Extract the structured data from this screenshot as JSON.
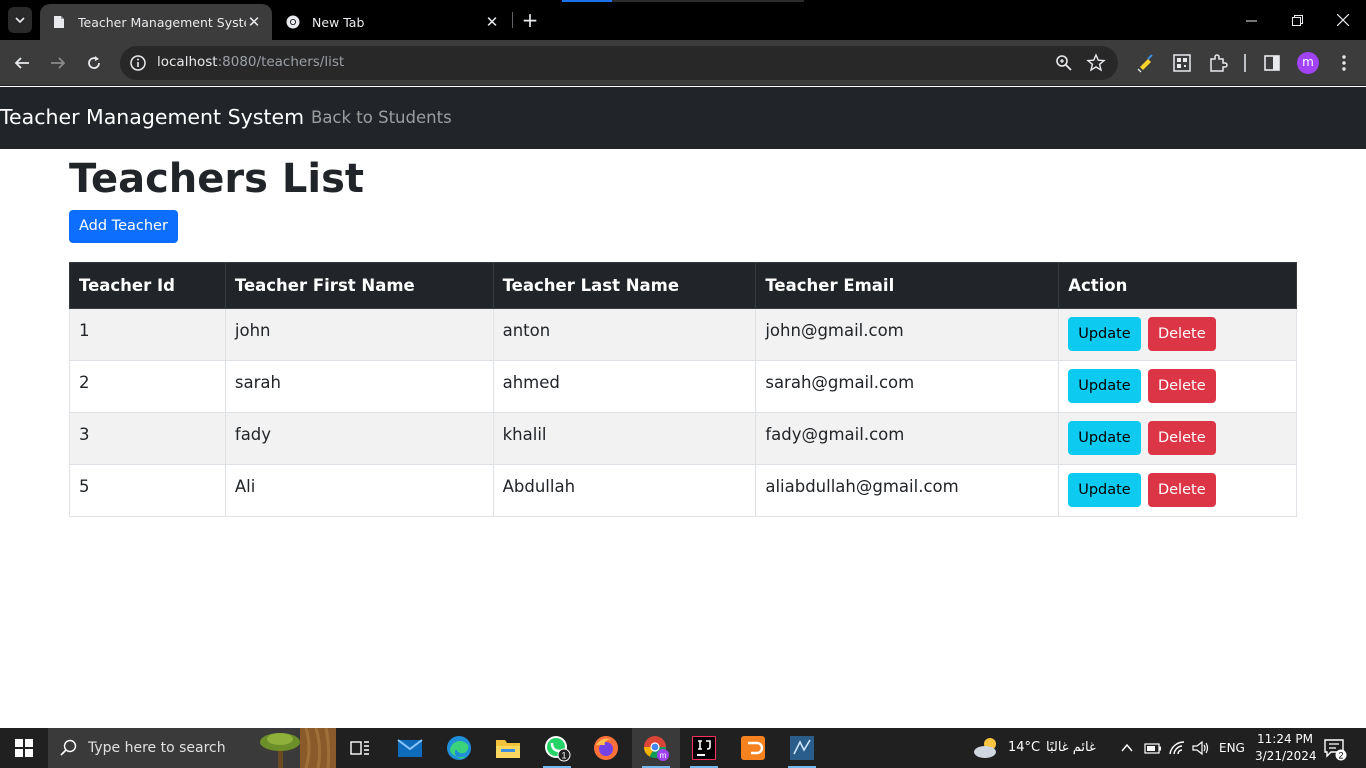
{
  "browser": {
    "tabs": [
      {
        "title": "Teacher Management System"
      },
      {
        "title": "New Tab"
      }
    ],
    "url_host": "localhost",
    "url_path": ":8080/teachers/list",
    "profile_initial": "m"
  },
  "navbar": {
    "brand": "Teacher Management System",
    "back_link": "Back to Students"
  },
  "main": {
    "heading": "Teachers List",
    "add_button": "Add Teacher",
    "columns": [
      "Teacher Id",
      "Teacher First Name",
      "Teacher Last Name",
      "Teacher Email",
      "Action"
    ],
    "rows": [
      {
        "id": "1",
        "first": "john",
        "last": "anton",
        "email": "john@gmail.com"
      },
      {
        "id": "2",
        "first": "sarah",
        "last": "ahmed",
        "email": "sarah@gmail.com"
      },
      {
        "id": "3",
        "first": "fady",
        "last": "khalil",
        "email": "fady@gmail.com"
      },
      {
        "id": "5",
        "first": "Ali",
        "last": "Abdullah",
        "email": "aliabdullah@gmail.com"
      }
    ],
    "update_label": "Update",
    "delete_label": "Delete"
  },
  "taskbar": {
    "search_placeholder": "Type here to search",
    "whatsapp_badge": "1",
    "weather_temp": "14°C",
    "weather_text": "غائم غالبًا",
    "language": "ENG",
    "time": "11:24 PM",
    "date": "3/21/2024",
    "notification_count": "2"
  },
  "colors": {
    "navbar_bg": "#212529",
    "primary": "#0d6efd",
    "info": "#0dcaf0",
    "danger": "#dc3545"
  }
}
